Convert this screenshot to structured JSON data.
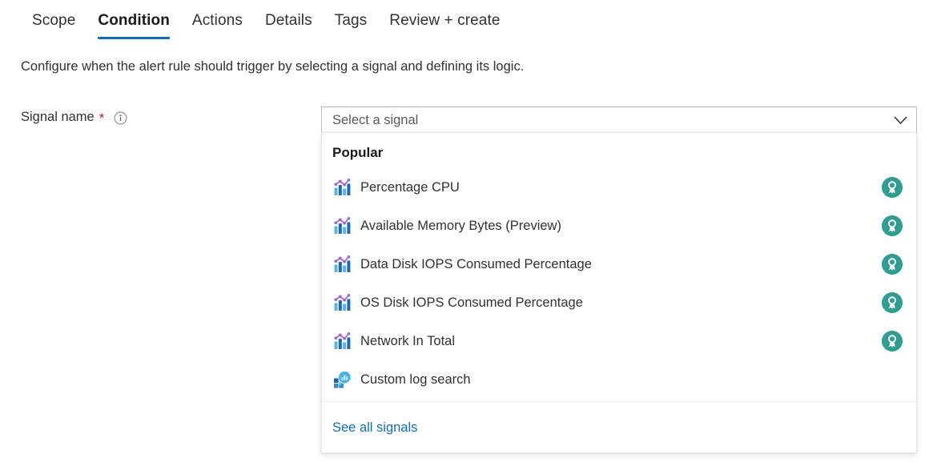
{
  "tabs": [
    {
      "label": "Scope",
      "selected": false
    },
    {
      "label": "Condition",
      "selected": true
    },
    {
      "label": "Actions",
      "selected": false
    },
    {
      "label": "Details",
      "selected": false
    },
    {
      "label": "Tags",
      "selected": false
    },
    {
      "label": "Review + create",
      "selected": false
    }
  ],
  "description": "Configure when the alert rule should trigger by selecting a signal and defining its logic.",
  "form": {
    "signal_name_label": "Signal name",
    "required_marker": "*",
    "info_icon": "info-circle-icon",
    "combobox": {
      "value": "",
      "placeholder": "Select a signal",
      "chevron_icon": "chevron-down-icon"
    }
  },
  "dropdown": {
    "group_header": "Popular",
    "items": [
      {
        "label": "Percentage CPU",
        "icon": "metric-chart-icon",
        "badge": "popular-award-badge-icon",
        "has_badge": true
      },
      {
        "label": "Available Memory Bytes (Preview)",
        "icon": "metric-chart-icon",
        "badge": "popular-award-badge-icon",
        "has_badge": true
      },
      {
        "label": "Data Disk IOPS Consumed Percentage",
        "icon": "metric-chart-icon",
        "badge": "popular-award-badge-icon",
        "has_badge": true
      },
      {
        "label": "OS Disk IOPS Consumed Percentage",
        "icon": "metric-chart-icon",
        "badge": "popular-award-badge-icon",
        "has_badge": true
      },
      {
        "label": "Network In Total",
        "icon": "metric-chart-icon",
        "badge": "popular-award-badge-icon",
        "has_badge": true
      },
      {
        "label": "Custom log search",
        "icon": "log-search-icon",
        "badge": "",
        "has_badge": false
      }
    ],
    "footer_link": "See all signals"
  },
  "colors": {
    "accent_blue": "#0f6cbd",
    "link_blue": "#0f6cbd",
    "required_red": "#a4262c",
    "badge_teal": "#2e9e92",
    "icon_purple": "#9b64d3",
    "icon_light_blue": "#5bb3ec",
    "icon_dark_blue": "#1b6cad",
    "text_primary": "#323130",
    "border_grey": "#bcbcbc"
  }
}
